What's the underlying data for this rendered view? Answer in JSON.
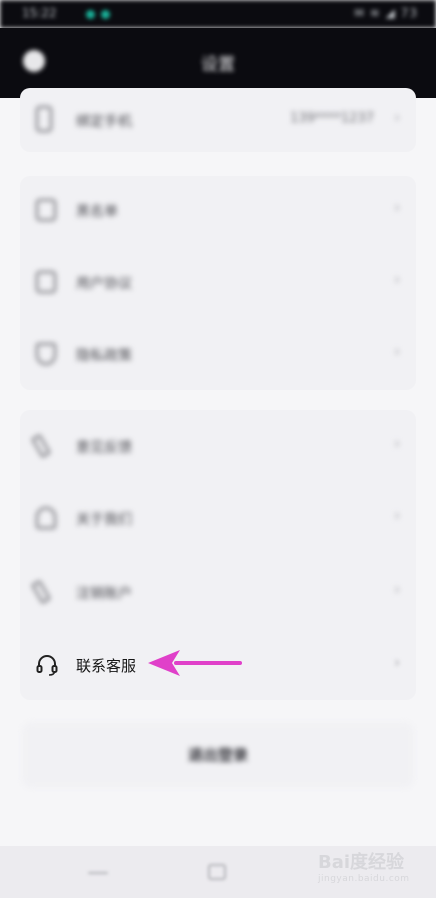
{
  "status_bar": {
    "time": "15:22",
    "right_icons": "✉ ≋ ◢ 73"
  },
  "header": {
    "title": "设置"
  },
  "card1": {
    "items": [
      {
        "label": "绑定手机",
        "value": "139****1237",
        "icon": "phone-icon"
      }
    ]
  },
  "card2": {
    "items": [
      {
        "label": "黑名单",
        "icon": "document-icon"
      },
      {
        "label": "用户协议",
        "icon": "document-icon"
      },
      {
        "label": "隐私政策",
        "icon": "shield-icon"
      }
    ]
  },
  "card3": {
    "items": [
      {
        "label": "意见反馈",
        "icon": "pen-icon"
      },
      {
        "label": "关于我们",
        "icon": "user-icon"
      },
      {
        "label": "注销账户",
        "icon": "pen-icon"
      }
    ]
  },
  "contact": {
    "label": "联系客服",
    "icon": "headset-icon"
  },
  "logout": {
    "label": "退出登录"
  },
  "annotation": {
    "color": "#e040c9"
  },
  "watermark": {
    "brand": "Bai度经验",
    "url": "jingyan.baidu.com"
  },
  "chevron": "›"
}
